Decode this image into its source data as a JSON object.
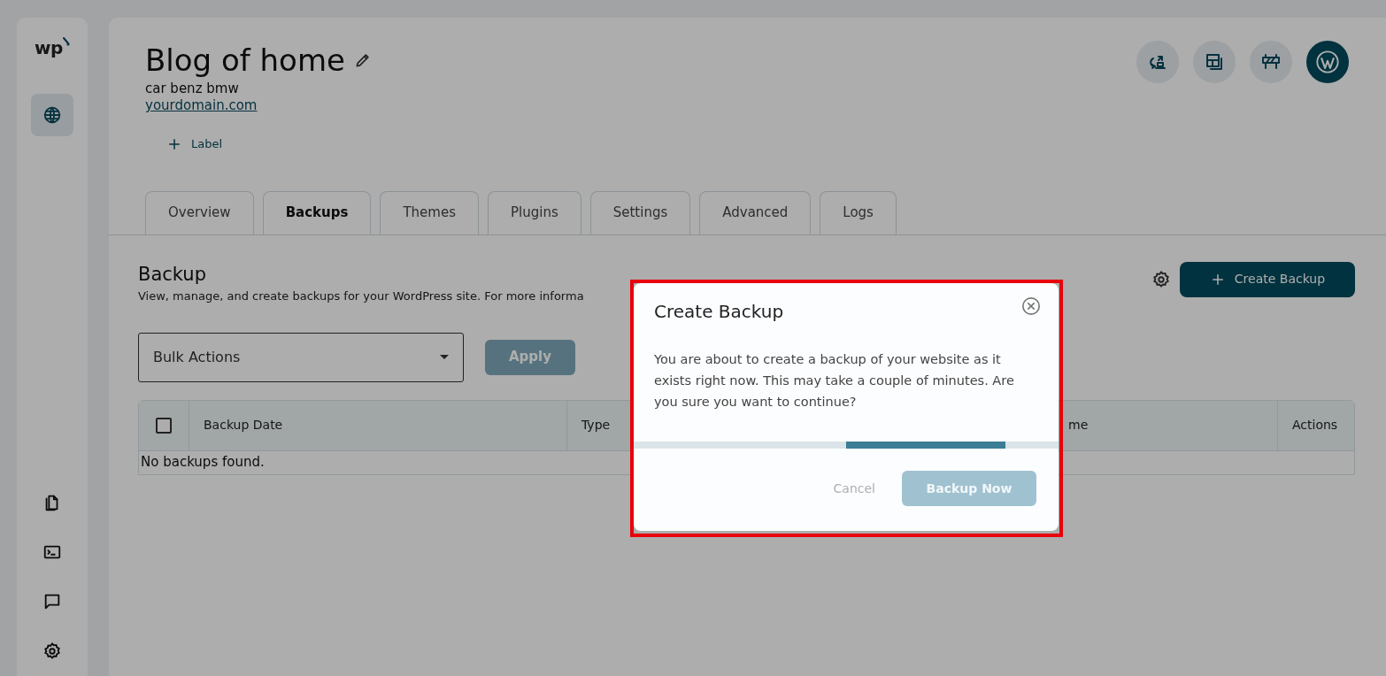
{
  "sidebar": {
    "logo": "wp",
    "items": [
      {
        "kind": "globe",
        "selected": true
      },
      {
        "kind": "pages",
        "selected": false
      },
      {
        "kind": "terminal",
        "selected": false
      },
      {
        "kind": "chat",
        "selected": false
      },
      {
        "kind": "settings",
        "selected": false
      }
    ]
  },
  "header": {
    "title": "Blog of home",
    "subtitle": "car benz bmw",
    "domain": "yourdomain.com",
    "add_label": "Label",
    "actions": [
      {
        "kind": "migrate"
      },
      {
        "kind": "layout"
      },
      {
        "kind": "maintenance"
      },
      {
        "kind": "wordpress"
      }
    ]
  },
  "tabs": [
    {
      "label": "Overview",
      "selected": false
    },
    {
      "label": "Backups",
      "selected": true
    },
    {
      "label": "Themes",
      "selected": false
    },
    {
      "label": "Plugins",
      "selected": false
    },
    {
      "label": "Settings",
      "selected": false
    },
    {
      "label": "Advanced",
      "selected": false
    },
    {
      "label": "Logs",
      "selected": false
    }
  ],
  "backup": {
    "title": "Backup",
    "description": "View, manage, and create backups for your WordPress site. For more informa",
    "create_button": "Create Backup",
    "bulk_select": {
      "value": "Bulk Actions"
    },
    "apply_button": {
      "label": "Apply",
      "disabled": true
    },
    "table": {
      "select_all": {
        "checked": false
      },
      "columns": [
        "Backup Date",
        "Type",
        "me",
        "Actions"
      ],
      "empty_message": "No backups found."
    }
  },
  "dialog": {
    "title": "Create Backup",
    "message": "You are about to create a backup of your website as it exists right now. This may take a couple of minutes. Are you sure you want to continue?",
    "loading": true,
    "buttons": [
      {
        "label": "Cancel",
        "kind": "link",
        "disabled": true
      },
      {
        "label": "Backup Now",
        "kind": "primary",
        "disabled": true
      }
    ]
  }
}
